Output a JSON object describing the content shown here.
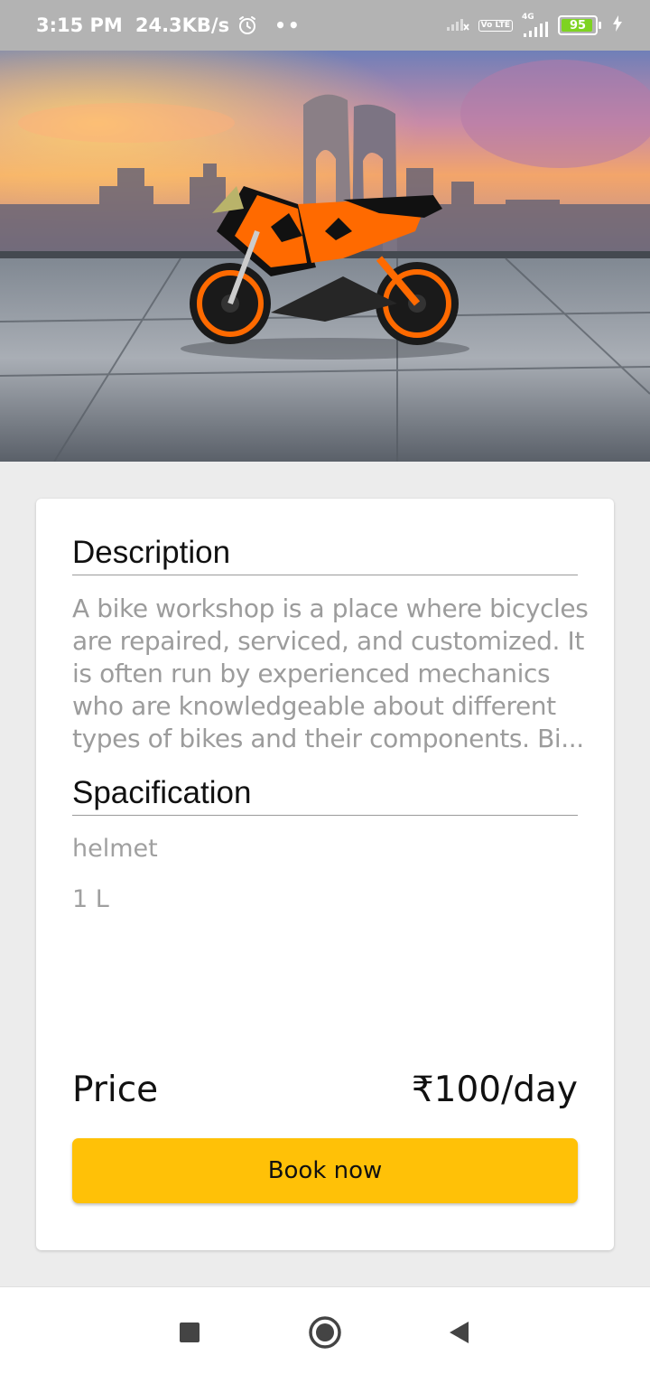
{
  "status_bar": {
    "time": "3:15 PM",
    "speed": "24.3KB/s",
    "network": "4G",
    "volte": "Vo LTE",
    "battery": "95",
    "battery_fraction": 0.95,
    "icons": [
      "alarm-icon",
      "signal-icon",
      "charging-icon"
    ]
  },
  "hero": {
    "alt": "Orange and black motorcycle parked in front of a city skyline at sunset"
  },
  "details": {
    "description_title": "Description",
    "description_lines": [
      "A bike workshop is a place where bicycles",
      "are repaired, serviced, and customized. It",
      "is often run by experienced mechanics",
      "who are knowledgeable about different",
      "types of bikes and their components. Bi..."
    ],
    "specification_title": "Spacification",
    "specifications": [
      "helmet",
      "1 L"
    ],
    "price_label": "Price",
    "price_value": "₹100/day",
    "book_button": "Book now"
  },
  "colors": {
    "accent": "#ffc107",
    "status_bar_bg": "#b3b3b3",
    "page_bg": "#ececec",
    "bike_orange": "#ff6a00"
  },
  "nav_bar": {
    "buttons": [
      "recents-square-icon",
      "home-circle-icon",
      "back-triangle-icon"
    ]
  }
}
